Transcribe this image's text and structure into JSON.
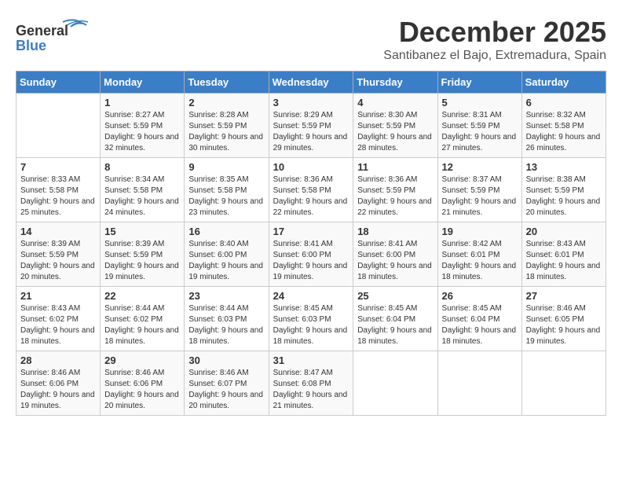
{
  "header": {
    "logo_line1": "General",
    "logo_line2": "Blue",
    "month": "December 2025",
    "location": "Santibanez el Bajo, Extremadura, Spain"
  },
  "weekdays": [
    "Sunday",
    "Monday",
    "Tuesday",
    "Wednesday",
    "Thursday",
    "Friday",
    "Saturday"
  ],
  "weeks": [
    [
      {
        "day": "",
        "sunrise": "",
        "sunset": "",
        "daylight": ""
      },
      {
        "day": "1",
        "sunrise": "Sunrise: 8:27 AM",
        "sunset": "Sunset: 5:59 PM",
        "daylight": "Daylight: 9 hours and 32 minutes."
      },
      {
        "day": "2",
        "sunrise": "Sunrise: 8:28 AM",
        "sunset": "Sunset: 5:59 PM",
        "daylight": "Daylight: 9 hours and 30 minutes."
      },
      {
        "day": "3",
        "sunrise": "Sunrise: 8:29 AM",
        "sunset": "Sunset: 5:59 PM",
        "daylight": "Daylight: 9 hours and 29 minutes."
      },
      {
        "day": "4",
        "sunrise": "Sunrise: 8:30 AM",
        "sunset": "Sunset: 5:59 PM",
        "daylight": "Daylight: 9 hours and 28 minutes."
      },
      {
        "day": "5",
        "sunrise": "Sunrise: 8:31 AM",
        "sunset": "Sunset: 5:59 PM",
        "daylight": "Daylight: 9 hours and 27 minutes."
      },
      {
        "day": "6",
        "sunrise": "Sunrise: 8:32 AM",
        "sunset": "Sunset: 5:58 PM",
        "daylight": "Daylight: 9 hours and 26 minutes."
      }
    ],
    [
      {
        "day": "7",
        "sunrise": "Sunrise: 8:33 AM",
        "sunset": "Sunset: 5:58 PM",
        "daylight": "Daylight: 9 hours and 25 minutes."
      },
      {
        "day": "8",
        "sunrise": "Sunrise: 8:34 AM",
        "sunset": "Sunset: 5:58 PM",
        "daylight": "Daylight: 9 hours and 24 minutes."
      },
      {
        "day": "9",
        "sunrise": "Sunrise: 8:35 AM",
        "sunset": "Sunset: 5:58 PM",
        "daylight": "Daylight: 9 hours and 23 minutes."
      },
      {
        "day": "10",
        "sunrise": "Sunrise: 8:36 AM",
        "sunset": "Sunset: 5:58 PM",
        "daylight": "Daylight: 9 hours and 22 minutes."
      },
      {
        "day": "11",
        "sunrise": "Sunrise: 8:36 AM",
        "sunset": "Sunset: 5:59 PM",
        "daylight": "Daylight: 9 hours and 22 minutes."
      },
      {
        "day": "12",
        "sunrise": "Sunrise: 8:37 AM",
        "sunset": "Sunset: 5:59 PM",
        "daylight": "Daylight: 9 hours and 21 minutes."
      },
      {
        "day": "13",
        "sunrise": "Sunrise: 8:38 AM",
        "sunset": "Sunset: 5:59 PM",
        "daylight": "Daylight: 9 hours and 20 minutes."
      }
    ],
    [
      {
        "day": "14",
        "sunrise": "Sunrise: 8:39 AM",
        "sunset": "Sunset: 5:59 PM",
        "daylight": "Daylight: 9 hours and 20 minutes."
      },
      {
        "day": "15",
        "sunrise": "Sunrise: 8:39 AM",
        "sunset": "Sunset: 5:59 PM",
        "daylight": "Daylight: 9 hours and 19 minutes."
      },
      {
        "day": "16",
        "sunrise": "Sunrise: 8:40 AM",
        "sunset": "Sunset: 6:00 PM",
        "daylight": "Daylight: 9 hours and 19 minutes."
      },
      {
        "day": "17",
        "sunrise": "Sunrise: 8:41 AM",
        "sunset": "Sunset: 6:00 PM",
        "daylight": "Daylight: 9 hours and 19 minutes."
      },
      {
        "day": "18",
        "sunrise": "Sunrise: 8:41 AM",
        "sunset": "Sunset: 6:00 PM",
        "daylight": "Daylight: 9 hours and 18 minutes."
      },
      {
        "day": "19",
        "sunrise": "Sunrise: 8:42 AM",
        "sunset": "Sunset: 6:01 PM",
        "daylight": "Daylight: 9 hours and 18 minutes."
      },
      {
        "day": "20",
        "sunrise": "Sunrise: 8:43 AM",
        "sunset": "Sunset: 6:01 PM",
        "daylight": "Daylight: 9 hours and 18 minutes."
      }
    ],
    [
      {
        "day": "21",
        "sunrise": "Sunrise: 8:43 AM",
        "sunset": "Sunset: 6:02 PM",
        "daylight": "Daylight: 9 hours and 18 minutes."
      },
      {
        "day": "22",
        "sunrise": "Sunrise: 8:44 AM",
        "sunset": "Sunset: 6:02 PM",
        "daylight": "Daylight: 9 hours and 18 minutes."
      },
      {
        "day": "23",
        "sunrise": "Sunrise: 8:44 AM",
        "sunset": "Sunset: 6:03 PM",
        "daylight": "Daylight: 9 hours and 18 minutes."
      },
      {
        "day": "24",
        "sunrise": "Sunrise: 8:45 AM",
        "sunset": "Sunset: 6:03 PM",
        "daylight": "Daylight: 9 hours and 18 minutes."
      },
      {
        "day": "25",
        "sunrise": "Sunrise: 8:45 AM",
        "sunset": "Sunset: 6:04 PM",
        "daylight": "Daylight: 9 hours and 18 minutes."
      },
      {
        "day": "26",
        "sunrise": "Sunrise: 8:45 AM",
        "sunset": "Sunset: 6:04 PM",
        "daylight": "Daylight: 9 hours and 18 minutes."
      },
      {
        "day": "27",
        "sunrise": "Sunrise: 8:46 AM",
        "sunset": "Sunset: 6:05 PM",
        "daylight": "Daylight: 9 hours and 19 minutes."
      }
    ],
    [
      {
        "day": "28",
        "sunrise": "Sunrise: 8:46 AM",
        "sunset": "Sunset: 6:06 PM",
        "daylight": "Daylight: 9 hours and 19 minutes."
      },
      {
        "day": "29",
        "sunrise": "Sunrise: 8:46 AM",
        "sunset": "Sunset: 6:06 PM",
        "daylight": "Daylight: 9 hours and 20 minutes."
      },
      {
        "day": "30",
        "sunrise": "Sunrise: 8:46 AM",
        "sunset": "Sunset: 6:07 PM",
        "daylight": "Daylight: 9 hours and 20 minutes."
      },
      {
        "day": "31",
        "sunrise": "Sunrise: 8:47 AM",
        "sunset": "Sunset: 6:08 PM",
        "daylight": "Daylight: 9 hours and 21 minutes."
      },
      {
        "day": "",
        "sunrise": "",
        "sunset": "",
        "daylight": ""
      },
      {
        "day": "",
        "sunrise": "",
        "sunset": "",
        "daylight": ""
      },
      {
        "day": "",
        "sunrise": "",
        "sunset": "",
        "daylight": ""
      }
    ]
  ]
}
